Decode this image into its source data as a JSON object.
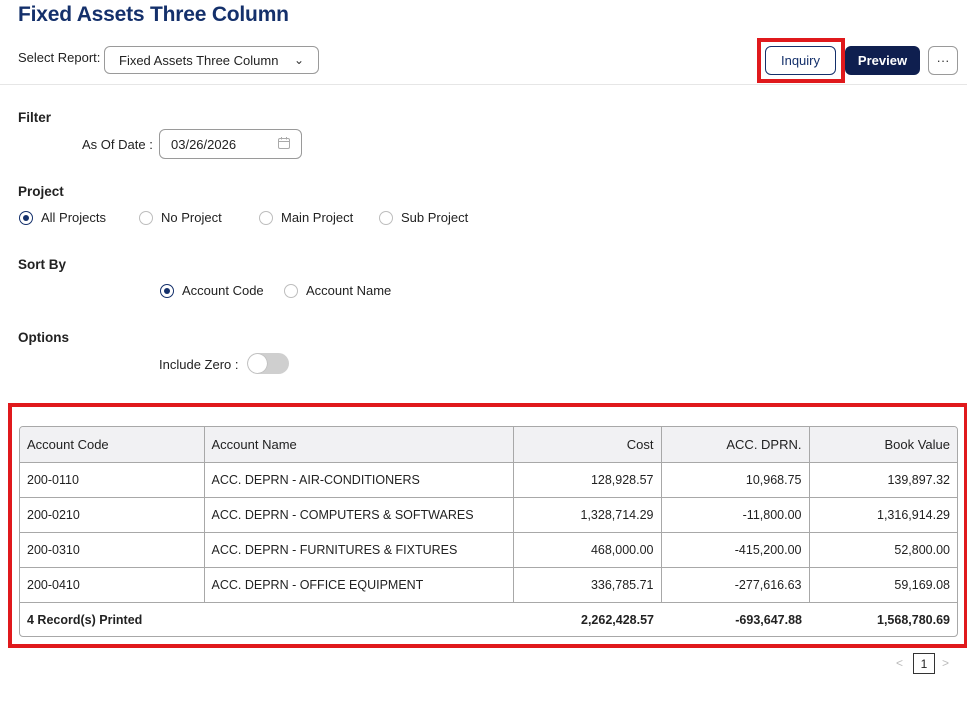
{
  "page": {
    "title": "Fixed Assets Three Column"
  },
  "header": {
    "select_report_label": "Select Report:",
    "select_report_value": "Fixed Assets Three Column",
    "inquiry_label": "Inquiry",
    "preview_label": "Preview",
    "more_label": "···"
  },
  "filter": {
    "title": "Filter",
    "as_of_date_label": "As Of Date :",
    "as_of_date_value": "03/26/2026"
  },
  "project": {
    "title": "Project",
    "options": [
      "All Projects",
      "No Project",
      "Main Project",
      "Sub Project"
    ],
    "selected": "All Projects"
  },
  "sort_by": {
    "title": "Sort By",
    "options": [
      "Account Code",
      "Account Name"
    ],
    "selected": "Account Code"
  },
  "options": {
    "title": "Options",
    "include_zero_label": "Include Zero :",
    "include_zero": false
  },
  "table": {
    "columns": [
      "Account Code",
      "Account Name",
      "Cost",
      "ACC. DPRN.",
      "Book Value"
    ],
    "rows": [
      {
        "code": "200-0110",
        "name": "ACC. DEPRN - AIR-CONDITIONERS",
        "cost": "128,928.57",
        "dprn": "10,968.75",
        "book": "139,897.32"
      },
      {
        "code": "200-0210",
        "name": "ACC. DEPRN - COMPUTERS & SOFTWARES",
        "cost": "1,328,714.29",
        "dprn": "-11,800.00",
        "book": "1,316,914.29"
      },
      {
        "code": "200-0310",
        "name": "ACC. DEPRN - FURNITURES & FIXTURES",
        "cost": "468,000.00",
        "dprn": "-415,200.00",
        "book": "52,800.00"
      },
      {
        "code": "200-0410",
        "name": "ACC. DEPRN - OFFICE EQUIPMENT",
        "cost": "336,785.71",
        "dprn": "-277,616.63",
        "book": "59,169.08"
      }
    ],
    "footer": {
      "records": "4 Record(s) Printed",
      "cost": "2,262,428.57",
      "dprn": "-693,647.88",
      "book": "1,568,780.69"
    }
  },
  "pagination": {
    "current_page": "1",
    "prev": "<",
    "next": ">"
  },
  "colors": {
    "brand": "#14306b",
    "primary_button": "#0f1f4f",
    "highlight": "#e0191c"
  }
}
